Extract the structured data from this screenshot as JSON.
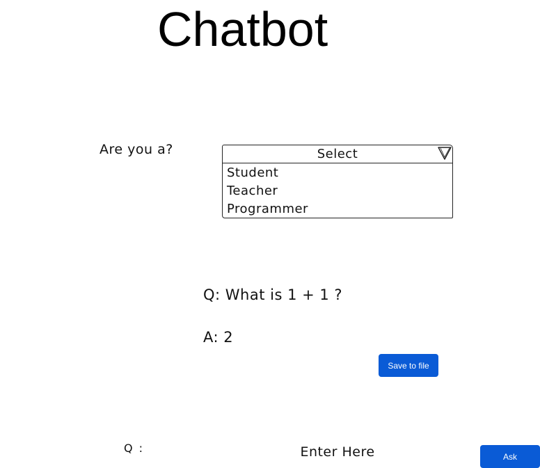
{
  "title": "Chatbot",
  "role": {
    "label": "Are you a?",
    "selected": "Select",
    "options": [
      "Student",
      "Teacher",
      "Programmer"
    ]
  },
  "conversation": {
    "question": "Q: What is 1 + 1 ?",
    "answer": "A: 2"
  },
  "actions": {
    "save_label": "Save to file",
    "ask_label": "Ask"
  },
  "input": {
    "label": "Q :",
    "placeholder": "Enter Here"
  },
  "icons": {
    "dropdown": "chevron-down-icon"
  },
  "colors": {
    "accent": "#0a5bd6"
  }
}
